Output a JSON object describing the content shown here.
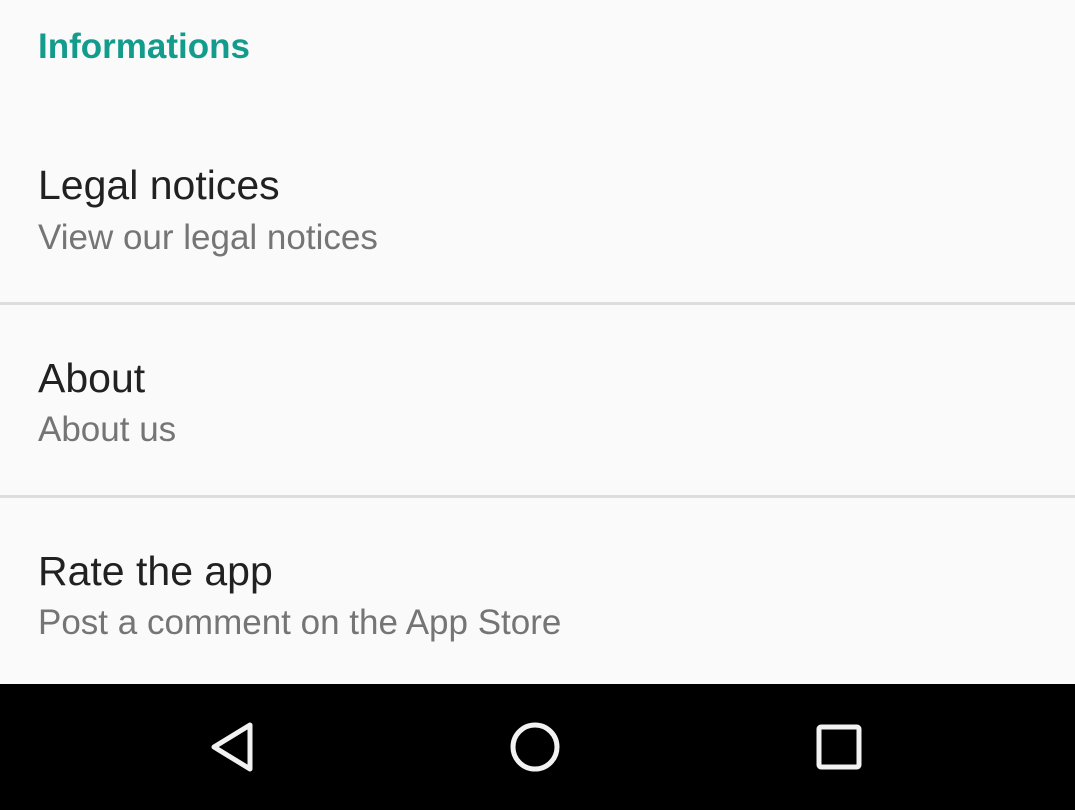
{
  "settings": {
    "section_title": "Informations",
    "items": [
      {
        "title": "Legal notices",
        "summary": "View our legal notices"
      },
      {
        "title": "About",
        "summary": "About us"
      },
      {
        "title": "Rate the app",
        "summary": "Post a comment on the App Store"
      }
    ]
  },
  "navbar": {
    "icons": [
      "back-icon",
      "home-icon",
      "recents-icon"
    ],
    "icon_color": "#f2f2f2"
  },
  "colors": {
    "accent": "#139c8c",
    "background": "#fafafa",
    "title_text": "#212121",
    "summary_text": "#757575",
    "navbar_background": "#000000"
  }
}
